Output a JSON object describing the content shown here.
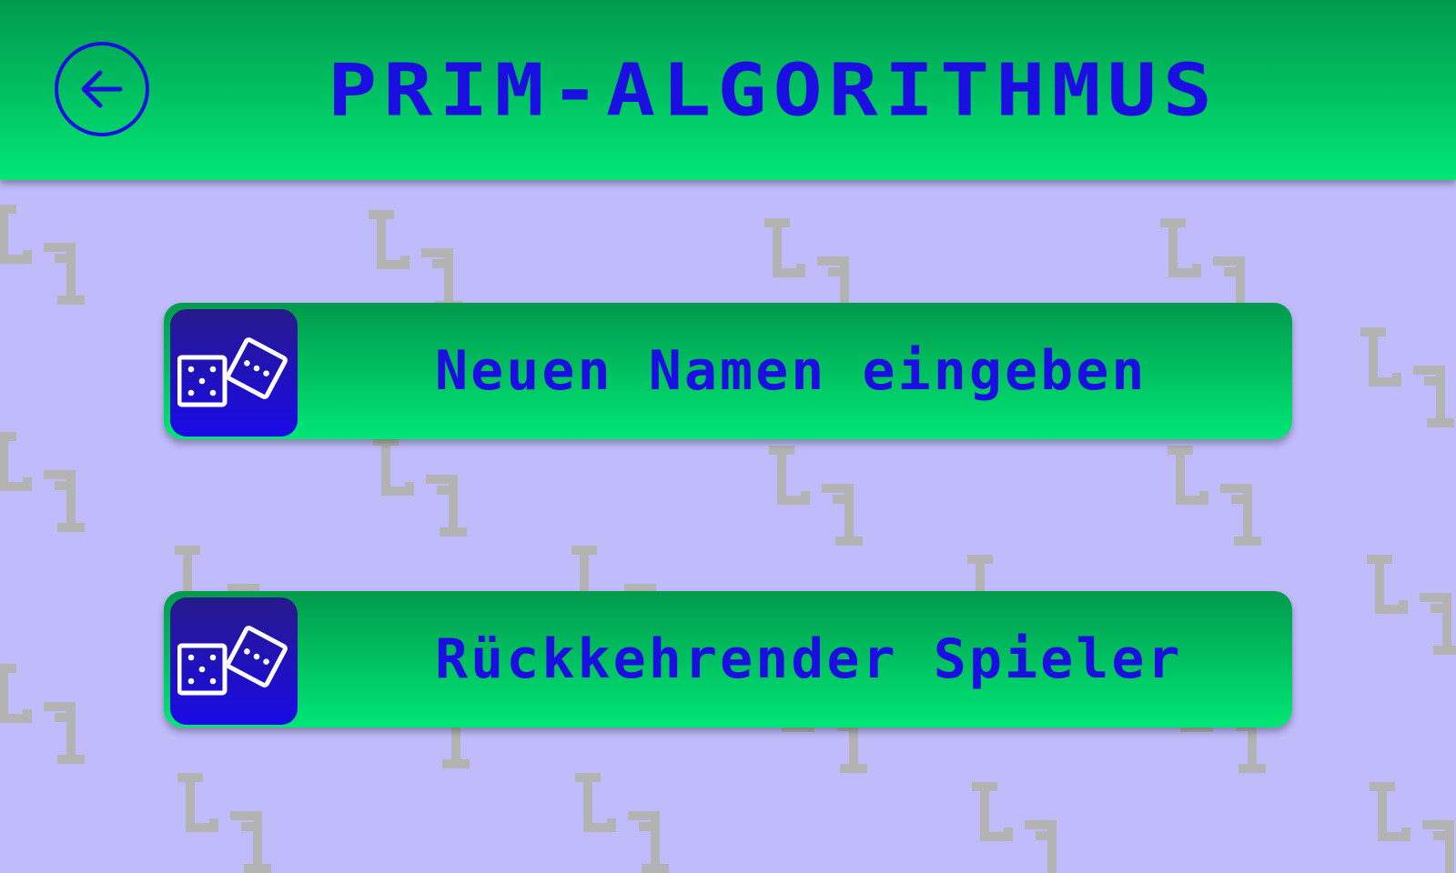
{
  "header": {
    "title": "PRIM-ALGORITHMUS",
    "back_icon": "arrow-left-icon"
  },
  "menu": [
    {
      "label": "Neuen Namen eingeben",
      "icon": "dice-icon"
    },
    {
      "label": "Rückkehrender Spieler",
      "icon": "dice-icon"
    }
  ],
  "colors": {
    "background": "#c0bcfc",
    "pattern": "#b3b3b3",
    "header_top": "#019a4c",
    "header_bottom": "#00e676",
    "accent": "#1a0ee0"
  }
}
